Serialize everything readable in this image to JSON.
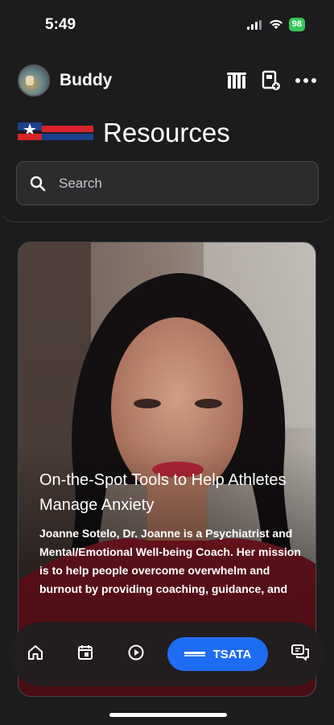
{
  "status_bar": {
    "time": "5:49",
    "battery": "98"
  },
  "header": {
    "username": "Buddy",
    "logo_text": "TSATA",
    "page_title": "Resources"
  },
  "search": {
    "placeholder": "Search"
  },
  "card": {
    "title": "On-the-Spot Tools to Help Athletes Manage Anxiety",
    "description": "Joanne Sotelo, Dr. Joanne is a Psychiatrist and Mental/Emotional Well-being Coach. Her mission is to help people overcome overwhelm and burnout by providing coaching, guidance, and"
  },
  "tab_bar": {
    "active_tab_label": "TSATA",
    "active_tab_logo": "TSATA"
  },
  "colors": {
    "accent": "#1e6cf2",
    "background": "#1c1c1e",
    "battery": "#34c759"
  }
}
